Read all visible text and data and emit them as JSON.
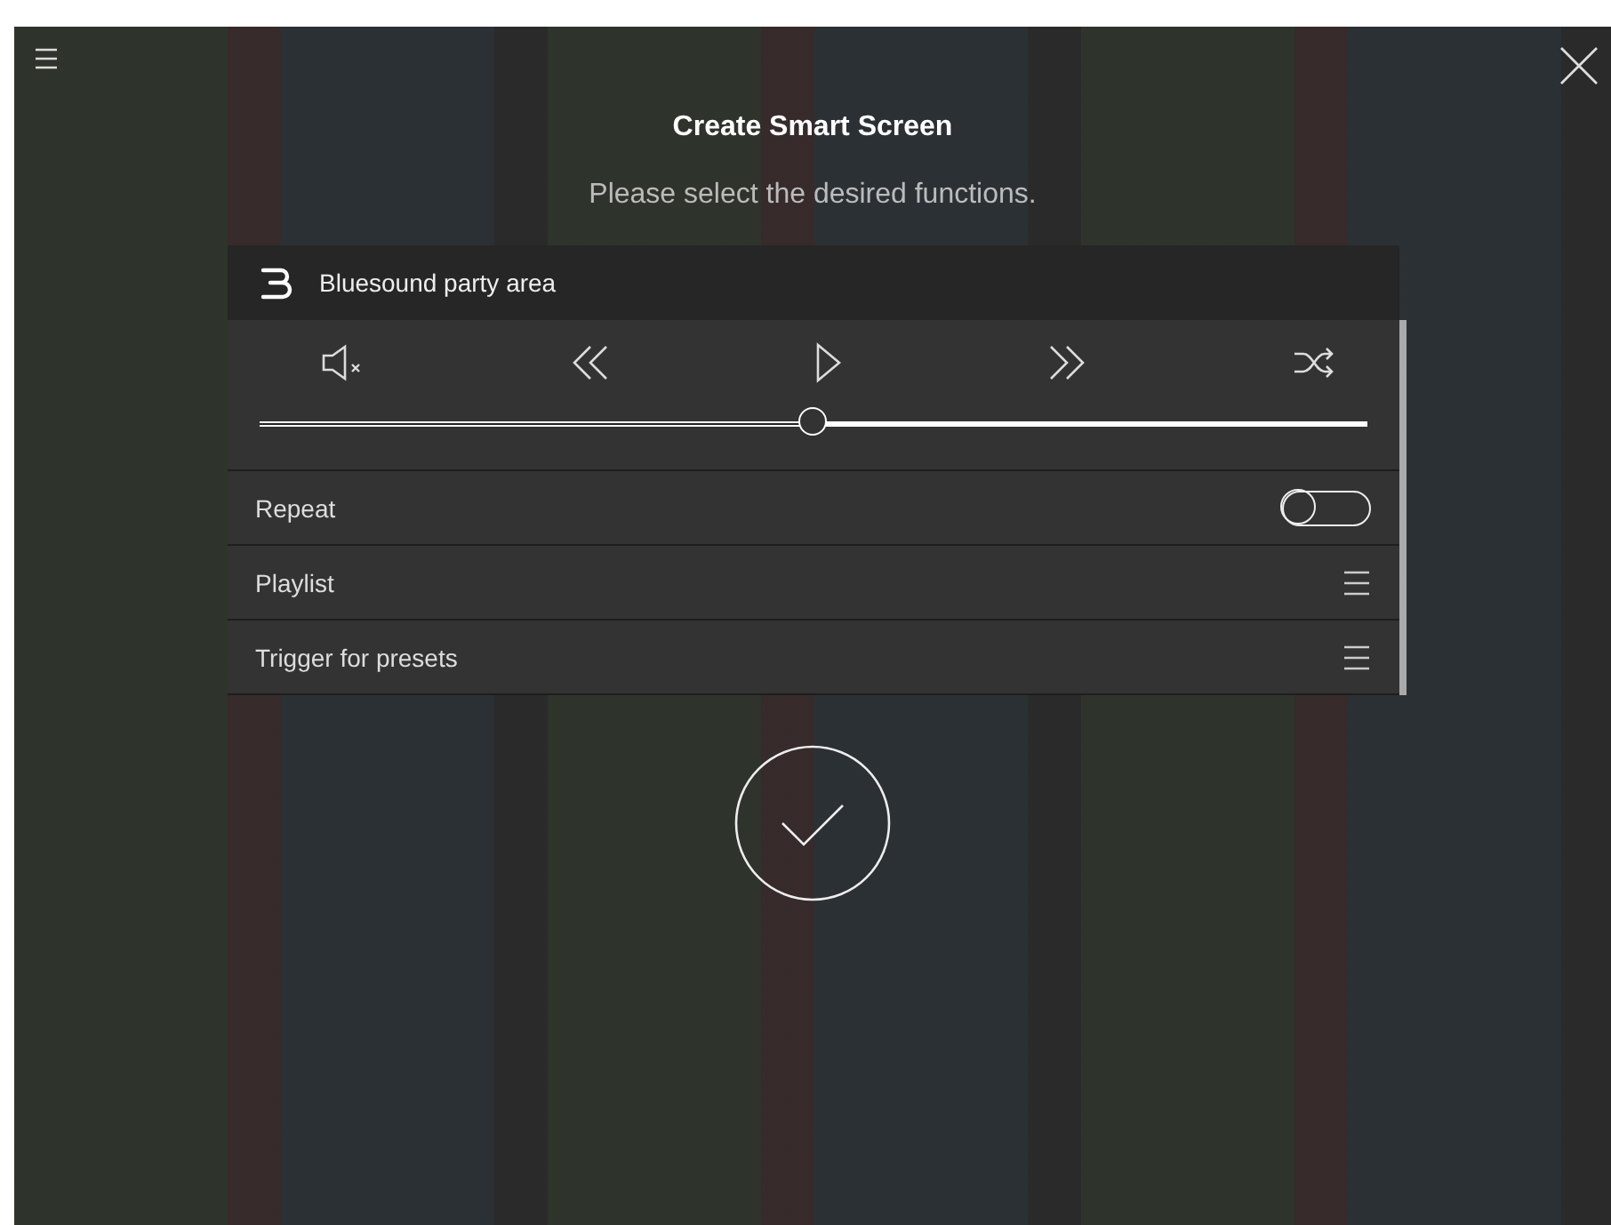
{
  "title": "Create Smart Screen",
  "subtitle": "Please select the desired functions.",
  "panel": {
    "header": "Bluesound party area",
    "controls": [
      {
        "kind": "mute"
      },
      {
        "kind": "previous"
      },
      {
        "kind": "play"
      },
      {
        "kind": "next"
      },
      {
        "kind": "shuffle"
      }
    ],
    "volume": {
      "level": 0.5
    },
    "rows": [
      {
        "kind": "toggle",
        "label": "Repeat",
        "on": false
      },
      {
        "kind": "menu",
        "label": "Playlist"
      },
      {
        "kind": "menu",
        "label": "Trigger for presets"
      }
    ]
  }
}
